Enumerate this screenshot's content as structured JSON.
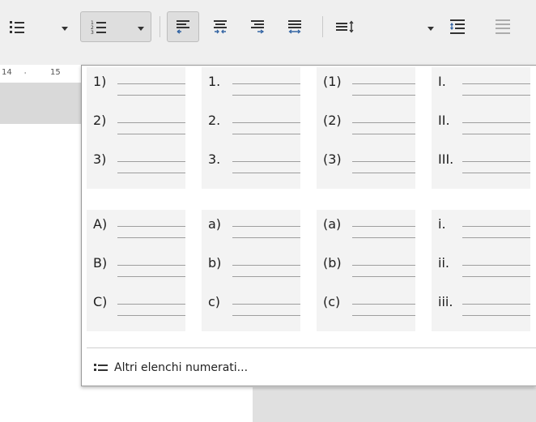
{
  "toolbar": {
    "buttons": [
      {
        "id": "bullets",
        "icon": "bullet-list-icon"
      },
      {
        "id": "numbering",
        "icon": "numbered-list-icon"
      },
      {
        "id": "align-left",
        "icon": "align-left-icon"
      },
      {
        "id": "align-center",
        "icon": "align-center-icon"
      },
      {
        "id": "align-right",
        "icon": "align-right-icon"
      },
      {
        "id": "justify",
        "icon": "align-justify-icon"
      },
      {
        "id": "line-spacing",
        "icon": "line-spacing-icon"
      },
      {
        "id": "increase-paragraph-spacing",
        "icon": "paragraph-spacing-increase-icon"
      },
      {
        "id": "decrease-paragraph-spacing",
        "icon": "paragraph-spacing-decrease-icon"
      }
    ]
  },
  "ruler": {
    "ticks": [
      "14",
      "15"
    ]
  },
  "menu": {
    "presets": [
      {
        "group": "numbers-parenthesis",
        "items": [
          "1)",
          "2)",
          "3)"
        ]
      },
      {
        "group": "numbers-dot",
        "items": [
          "1.",
          "2.",
          "3."
        ]
      },
      {
        "group": "numbers-brackets",
        "items": [
          "(1)",
          "(2)",
          "(3)"
        ]
      },
      {
        "group": "roman-upper",
        "items": [
          "I.",
          "II.",
          "III."
        ]
      },
      {
        "group": "letters-upper-parenthesis",
        "items": [
          "A)",
          "B)",
          "C)"
        ]
      },
      {
        "group": "letters-lower-parenthesis",
        "items": [
          "a)",
          "b)",
          "c)"
        ]
      },
      {
        "group": "letters-lower-brackets",
        "items": [
          "(a)",
          "(b)",
          "(c)"
        ]
      },
      {
        "group": "roman-lower",
        "items": [
          "i.",
          "ii.",
          "iii."
        ]
      }
    ],
    "more_label": "Altri elenchi numerati..."
  },
  "colors": {
    "accent": "#3465a4",
    "toolbar": "#efefef",
    "cell": "#f3f3f3"
  }
}
